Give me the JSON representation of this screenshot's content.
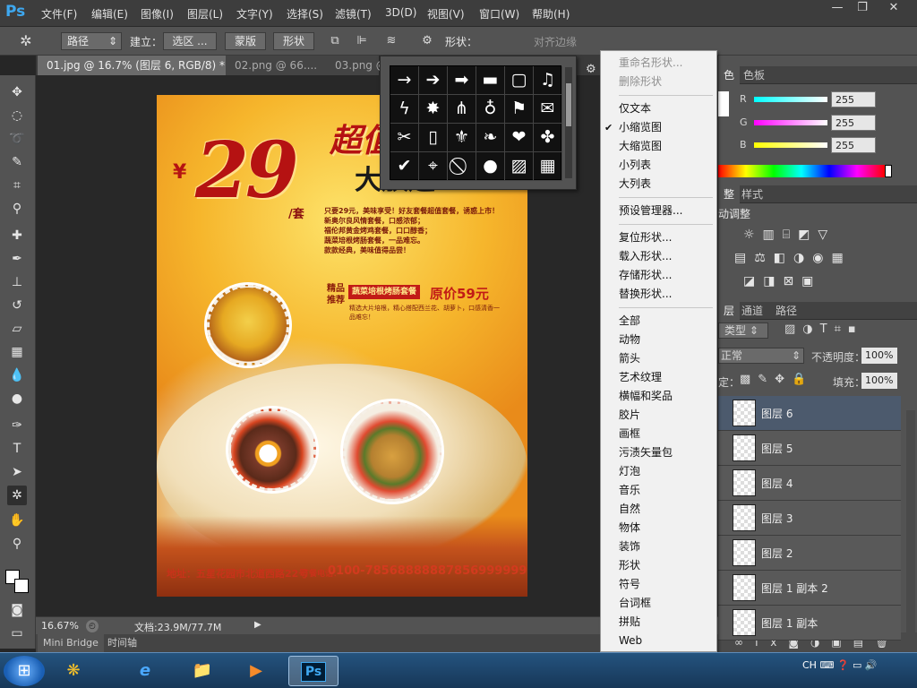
{
  "menubar": {
    "logo": "Ps",
    "items": [
      "文件(F)",
      "编辑(E)",
      "图像(I)",
      "图层(L)",
      "文字(Y)",
      "选择(S)",
      "滤镜(T)",
      "3D(D)",
      "视图(V)",
      "窗口(W)",
      "帮助(H)"
    ],
    "window_controls": [
      "—",
      "❐",
      "✕"
    ]
  },
  "options_bar": {
    "mode": "路径",
    "make_label": "建立：",
    "selection_btn": "选区 ...",
    "mask_btn": "蒙版",
    "shape_btn": "形状",
    "shape_label": "形状：",
    "align_edges": "对齐边缘"
  },
  "doc_tabs": [
    "01.jpg @ 16.7% (图层 6, RGB/8) *  ×",
    "02.png @ 66....",
    "03.png @"
  ],
  "poster": {
    "price": "29",
    "yen": "¥",
    "unit": "/套",
    "headline": "超值",
    "headline2": "大放送",
    "lines": [
      "只要29元，美味享受！好友套餐超值套餐，诱惑上市！",
      "新奥尔良风情套餐，口感浓郁；",
      "福伦邦黄金烤鸡套餐，口口醇香；",
      "蔬菜培根烤肠套餐，一品难忘。",
      "款款经典，美味值得品尝！"
    ],
    "tuijian": "精品推荐",
    "set_name": "蔬菜培根烤肠套餐",
    "orig_price": "原价59元",
    "desc": "精选大片培根，精心搭配西兰花、胡萝卜，口感清香一品难忘！",
    "address": "地址：五星花园市北道西路22号",
    "call": "订餐电话：",
    "phone1": "0100-7856888888",
    "phone2": "7856999999"
  },
  "status": {
    "zoom": "16.67%",
    "doc": "文档:23.9M/77.7M"
  },
  "bottom_tabs": [
    "Mini Bridge",
    "时间轴"
  ],
  "color_panel": {
    "tabs": [
      "色",
      "色板"
    ],
    "channels": [
      {
        "name": "R",
        "value": "255"
      },
      {
        "name": "G",
        "value": "255"
      },
      {
        "name": "B",
        "value": "255"
      }
    ]
  },
  "adjust_panel": {
    "tabs": [
      "整",
      "样式"
    ],
    "title": "动调整"
  },
  "layers_panel": {
    "tabs": [
      "层",
      "通道",
      "路径"
    ],
    "kind": "类型",
    "blend": "正常",
    "opacity_label": "不透明度：",
    "opacity": "100%",
    "lock_label": "定：",
    "fill_label": "填充：",
    "fill": "100%",
    "layers": [
      "图层 6",
      "图层 5",
      "图层 4",
      "图层 3",
      "图层 2",
      "图层 1 副本 2",
      "图层 1 副本"
    ]
  },
  "shape_picker": {
    "shapes": [
      "→",
      "➔",
      "➡",
      "▬",
      "▢",
      "♫",
      "ϟ",
      "✸",
      "⋔",
      "♁",
      "⚑",
      "✉",
      "✂",
      "▯",
      "⚜",
      "❧",
      "❤",
      "✤",
      "✔",
      "⌖",
      "⃠",
      "●",
      "▨",
      "▦"
    ]
  },
  "context_menu": {
    "items": [
      {
        "label": "重命名形状...",
        "disabled": true
      },
      {
        "label": "删除形状",
        "disabled": true
      },
      {
        "sep": true
      },
      {
        "label": "仅文本"
      },
      {
        "label": "小缩览图",
        "checked": true
      },
      {
        "label": "大缩览图"
      },
      {
        "label": "小列表"
      },
      {
        "label": "大列表"
      },
      {
        "sep": true
      },
      {
        "label": "预设管理器..."
      },
      {
        "sep": true
      },
      {
        "label": "复位形状..."
      },
      {
        "label": "载入形状..."
      },
      {
        "label": "存储形状..."
      },
      {
        "label": "替换形状..."
      },
      {
        "sep": true
      },
      {
        "label": "全部"
      },
      {
        "label": "动物"
      },
      {
        "label": "箭头"
      },
      {
        "label": "艺术纹理"
      },
      {
        "label": "横幅和奖品"
      },
      {
        "label": "胶片"
      },
      {
        "label": "画框"
      },
      {
        "label": "污渍矢量包"
      },
      {
        "label": "灯泡"
      },
      {
        "label": "音乐"
      },
      {
        "label": "自然"
      },
      {
        "label": "物体"
      },
      {
        "label": "装饰"
      },
      {
        "label": "形状"
      },
      {
        "label": "符号"
      },
      {
        "label": "台词框"
      },
      {
        "label": "拼贴"
      },
      {
        "label": "Web"
      }
    ]
  },
  "taskbar": {
    "apps": [
      "⊞",
      "❋",
      "e",
      "📁",
      "▶",
      "Ps"
    ],
    "lang": "CH"
  }
}
